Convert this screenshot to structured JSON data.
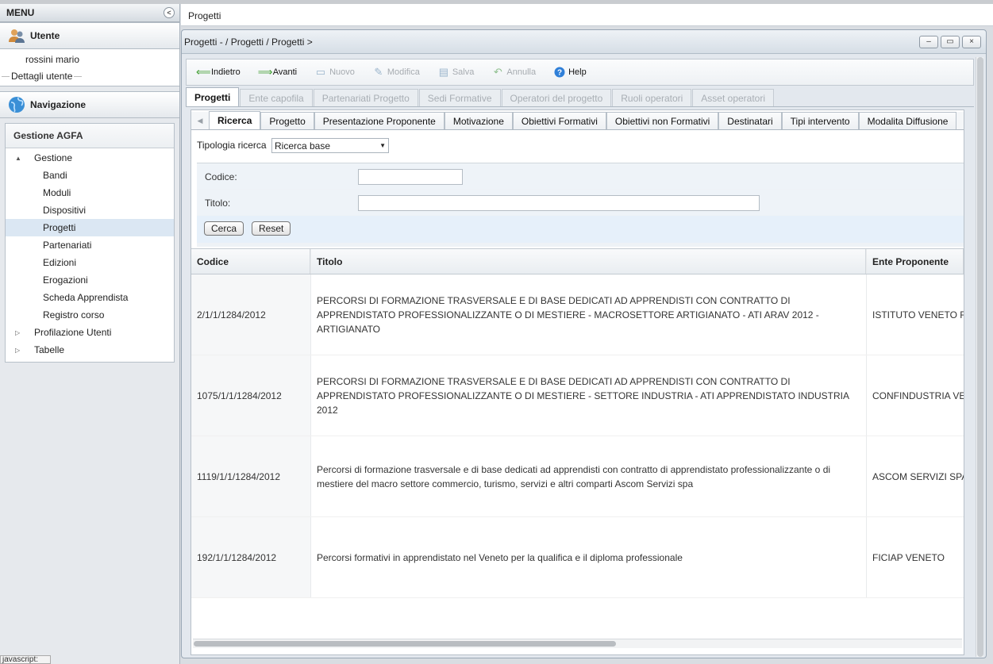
{
  "menu": {
    "title": "MENU"
  },
  "user": {
    "section": "Utente",
    "name": "rossini mario",
    "details": "Dettagli utente"
  },
  "nav": {
    "section": "Navigazione",
    "group": "Gestione AGFA",
    "tree": [
      {
        "label": "Gestione",
        "level": 0,
        "twisty": "▲"
      },
      {
        "label": "Bandi",
        "level": 1
      },
      {
        "label": "Moduli",
        "level": 1
      },
      {
        "label": "Dispositivi",
        "level": 1
      },
      {
        "label": "Progetti",
        "level": 1,
        "selected": true
      },
      {
        "label": "Partenariati",
        "level": 1
      },
      {
        "label": "Edizioni",
        "level": 1
      },
      {
        "label": "Erogazioni",
        "level": 1
      },
      {
        "label": "Scheda Apprendista",
        "level": 1
      },
      {
        "label": "Registro corso",
        "level": 1
      },
      {
        "label": "Profilazione Utenti",
        "level": 0,
        "twisty": "▷"
      },
      {
        "label": "Tabelle",
        "level": 0,
        "twisty": "▷"
      }
    ]
  },
  "topbar": {
    "title": "Progetti"
  },
  "window": {
    "title": "Progetti - / Progetti / Progetti >"
  },
  "toolbar": {
    "back": "Indietro",
    "forward": "Avanti",
    "new": "Nuovo",
    "edit": "Modifica",
    "save": "Salva",
    "cancel": "Annulla",
    "help": "Help"
  },
  "tabs1": [
    "Progetti",
    "Ente capofila",
    "Partenariati Progetto",
    "Sedi Formative",
    "Operatori del progetto",
    "Ruoli operatori",
    "Asset operatori"
  ],
  "tabs2": [
    "Ricerca",
    "Progetto",
    "Presentazione Proponente",
    "Motivazione",
    "Obiettivi Formativi",
    "Obiettivi non Formativi",
    "Destinatari",
    "Tipi intervento",
    "Modalita Diffusione"
  ],
  "search": {
    "type_label": "Tipologia ricerca",
    "type_value": "Ricerca base",
    "code_label": "Codice:",
    "title_label": "Titolo:",
    "code_value": "",
    "title_value": "",
    "search_btn": "Cerca",
    "reset_btn": "Reset"
  },
  "grid": {
    "headers": [
      "Codice",
      "Titolo",
      "Ente Proponente"
    ],
    "rows": [
      [
        "2/1/1/1284/2012",
        "PERCORSI DI FORMAZIONE TRASVERSALE E DI BASE DEDICATI AD APPRENDISTI CON CONTRATTO DI APPRENDISTATO PROFESSIONALIZZANTE O DI MESTIERE - MACROSETTORE ARTIGIANATO - ATI ARAV 2012 - ARTIGIANATO",
        "ISTITUTO VENETO F"
      ],
      [
        "1075/1/1/1284/2012",
        "PERCORSI DI FORMAZIONE TRASVERSALE E DI BASE DEDICATI AD APPRENDISTI CON CONTRATTO DI APPRENDISTATO PROFESSIONALIZZANTE O DI MESTIERE - SETTORE INDUSTRIA - ATI APPRENDISTATO INDUSTRIA 2012",
        "CONFINDUSTRIA VE"
      ],
      [
        "1119/1/1/1284/2012",
        "Percorsi di formazione trasversale e di base dedicati ad apprendisti con contratto di apprendistato professionalizzante o di mestiere del macro settore commercio, turismo, servizi e altri comparti Ascom Servizi spa",
        "ASCOM SERVIZI SPA"
      ],
      [
        "192/1/1/1284/2012",
        "Percorsi formativi in apprendistato nel Veneto per la qualifica e il diploma professionale",
        "FICIAP VENETO"
      ]
    ]
  },
  "status": {
    "text": "javascript:"
  }
}
